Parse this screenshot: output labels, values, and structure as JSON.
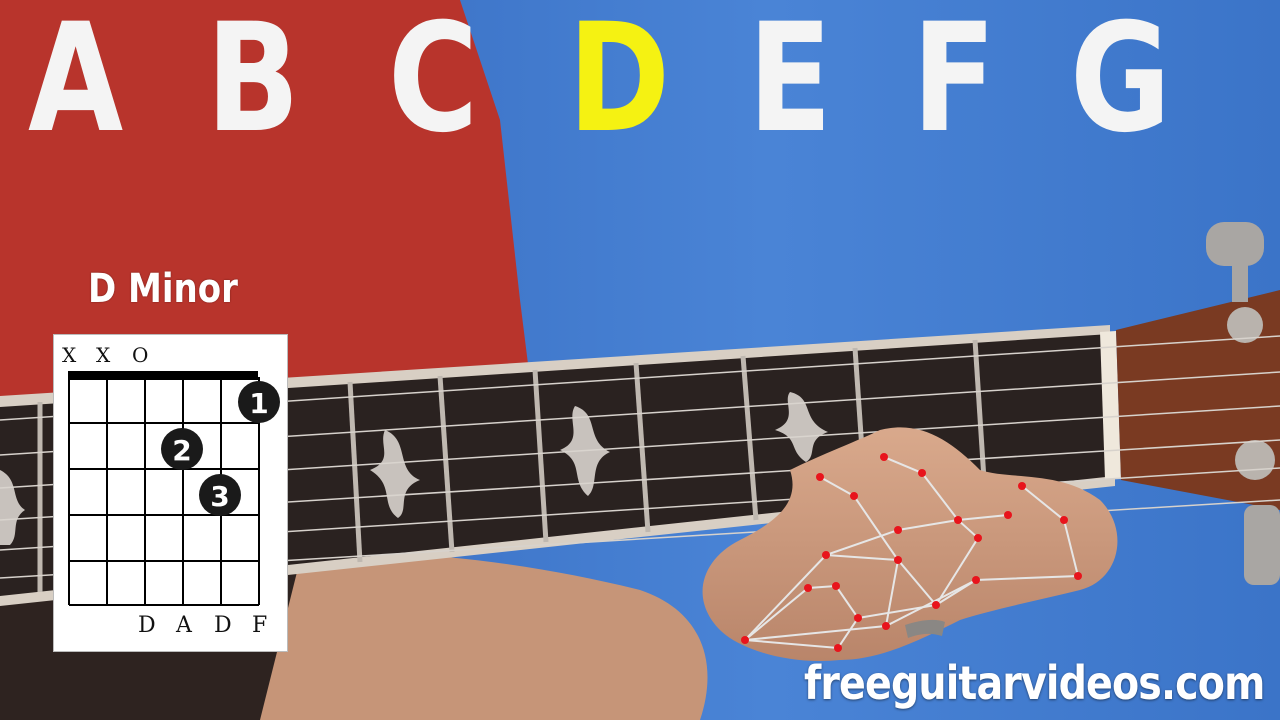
{
  "header": {
    "letters": [
      "A",
      "B",
      "C",
      "D",
      "E",
      "F",
      "G"
    ],
    "highlight_color": "#f5f212",
    "default_color": "#f4f4f4"
  },
  "chord": {
    "name": "D Minor",
    "string_markers": [
      "X",
      "X",
      "O"
    ],
    "fingers": [
      {
        "label": "1",
        "string": 6,
        "fret": 1
      },
      {
        "label": "2",
        "string": 4,
        "fret": 2
      },
      {
        "label": "3",
        "string": 5,
        "fret": 3
      }
    ],
    "notes": [
      "D",
      "A",
      "D",
      "F"
    ]
  },
  "watermark": "freeguitarvideos.com",
  "colors": {
    "background": "#3a72c9",
    "shirt": "#b8342c",
    "fretboard": "#2a2220",
    "landmark": "#e8141c"
  }
}
